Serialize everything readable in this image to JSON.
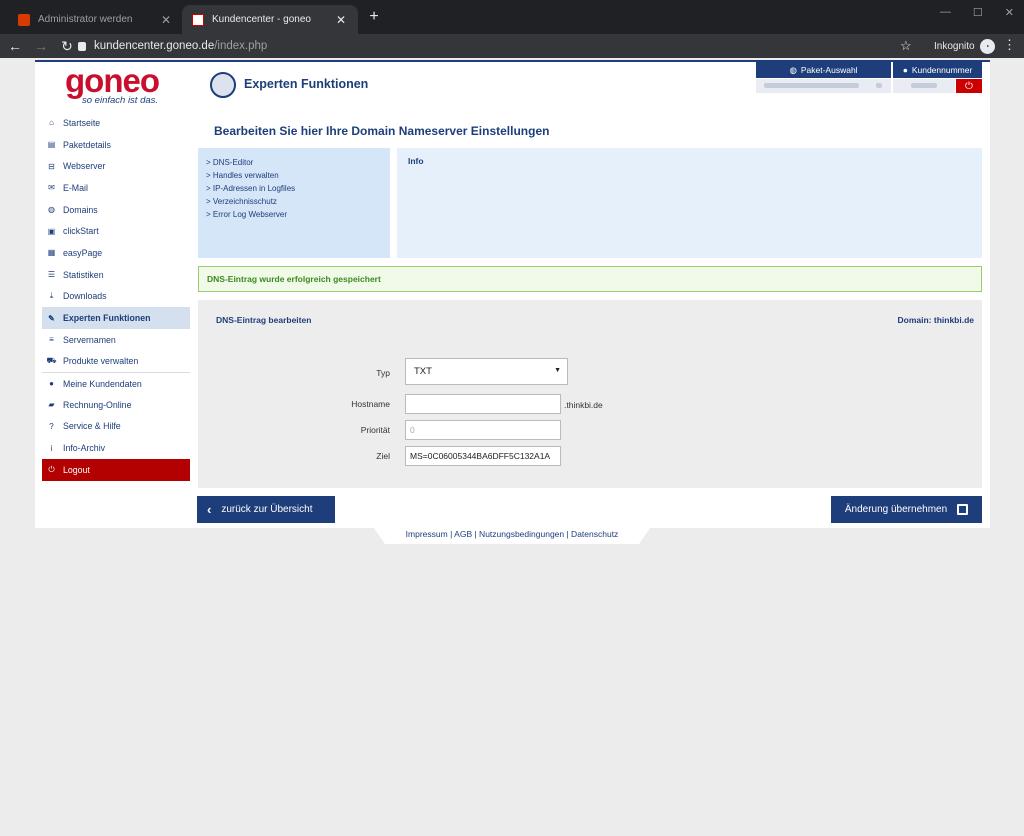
{
  "browser": {
    "tabs": [
      {
        "title": "Administrator werden",
        "active": false
      },
      {
        "title": "Kundencenter - goneo",
        "active": true
      }
    ],
    "url_host": "kundencenter.goneo.de",
    "url_path": "/index.php",
    "incognito_label": "Inkognito"
  },
  "brand": {
    "logo": "goneo",
    "slogan": "so einfach ist das."
  },
  "header": {
    "title": "Experten Funktionen",
    "paket_button": "Paket-Auswahl",
    "kunde_button": "Kundennummer"
  },
  "sidebar": {
    "items": [
      {
        "label": "Startseite",
        "icon": "home-icon"
      },
      {
        "label": "Paketdetails",
        "icon": "table-icon"
      },
      {
        "label": "Webserver",
        "icon": "server-icon"
      },
      {
        "label": "E-Mail",
        "icon": "mail-icon"
      },
      {
        "label": "Domains",
        "icon": "globe-icon"
      },
      {
        "label": "clickStart",
        "icon": "cubes-icon"
      },
      {
        "label": "easyPage",
        "icon": "grid-icon"
      },
      {
        "label": "Statistiken",
        "icon": "list-icon"
      },
      {
        "label": "Downloads",
        "icon": "download-icon"
      },
      {
        "label": "Experten Funktionen",
        "icon": "wrench-icon"
      },
      {
        "label": "Servernamen",
        "icon": "lines-icon"
      },
      {
        "label": "Produkte verwalten",
        "icon": "cart-icon"
      },
      {
        "label": "Meine Kundendaten",
        "icon": "user-icon"
      },
      {
        "label": "Rechnung-Online",
        "icon": "book-icon"
      },
      {
        "label": "Service & Hilfe",
        "icon": "question-icon"
      },
      {
        "label": "Info-Archiv",
        "icon": "info-icon"
      },
      {
        "label": "Logout",
        "icon": "power-icon"
      }
    ]
  },
  "main": {
    "title": "Bearbeiten Sie hier Ihre Domain Nameserver Einstellungen",
    "links": [
      "> DNS-Editor",
      "> Handles verwalten",
      "> IP-Adressen in Logfiles",
      "> Verzeichnisschutz",
      "> Error Log Webserver"
    ],
    "info_title": "Info",
    "success_message": "DNS-Eintrag wurde erfolgreich gespeichert"
  },
  "form": {
    "title": "DNS-Eintrag bearbeiten",
    "domain_label": "Domain: thinkbi.de",
    "type_label": "Typ",
    "type_value": "TXT",
    "hostname_label": "Hostname",
    "hostname_value": "",
    "hostname_suffix": ".thinkbi.de",
    "priority_label": "Priorität",
    "priority_placeholder": "0",
    "target_label": "Ziel",
    "target_value": "MS=0C06005344BA6DFF5C132A1A"
  },
  "actions": {
    "back_label": "zurück zur Übersicht",
    "save_label": "Änderung übernehmen"
  },
  "footer": {
    "text": "Impressum | AGB | Nutzungsbedingungen | Datenschutz"
  }
}
